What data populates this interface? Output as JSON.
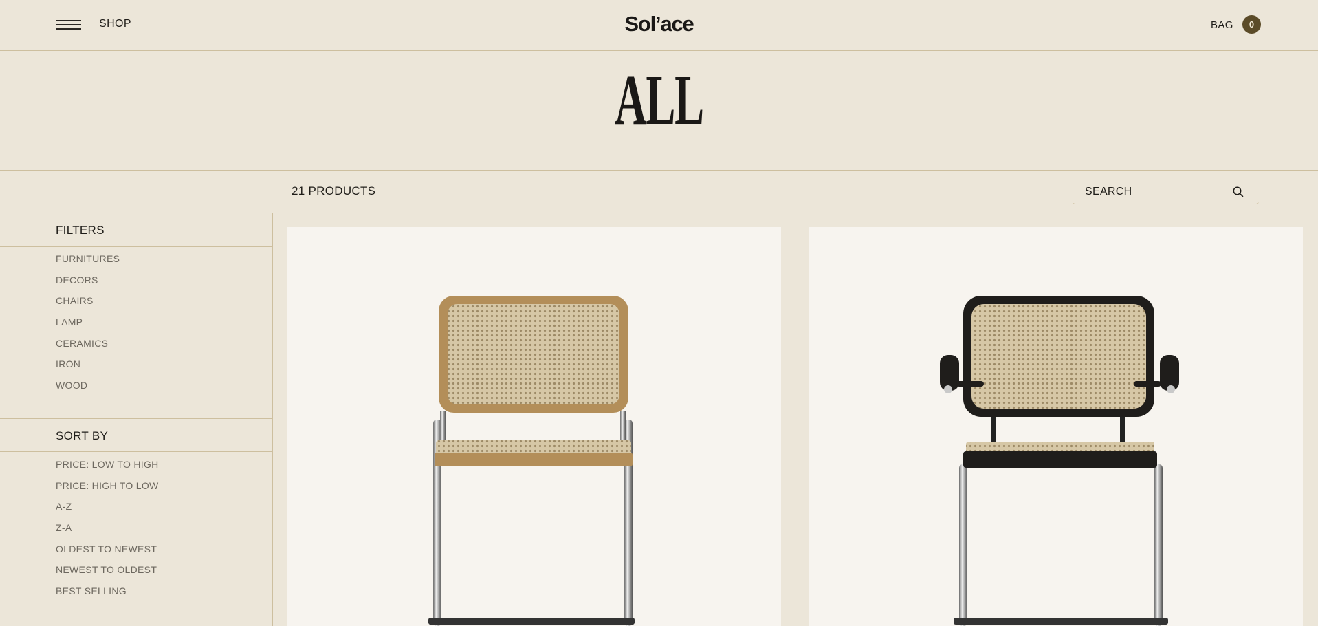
{
  "header": {
    "menu_icon": "hamburger-icon",
    "shop_label": "SHOP",
    "logo": "Sol’ace",
    "bag_label": "BAG",
    "bag_count": "0"
  },
  "hero": {
    "title": "ALL"
  },
  "toolbar": {
    "product_count": "21 PRODUCTS",
    "search_placeholder": "SEARCH",
    "search_icon": "search-icon"
  },
  "sidebar": {
    "filters_title": "FILTERS",
    "filters": [
      "FURNITURES",
      "DECORS",
      "CHAIRS",
      "LAMP",
      "CERAMICS",
      "IRON",
      "WOOD"
    ],
    "sort_title": "SORT BY",
    "sort_options": [
      "PRICE: LOW TO HIGH",
      "PRICE: HIGH TO LOW",
      "A-Z",
      "Z-A",
      "OLDEST TO NEWEST",
      "NEWEST TO OLDEST",
      "BEST SELLING"
    ]
  },
  "products": [
    {
      "image": "cane-chair-natural-wood"
    },
    {
      "image": "cane-armchair-black-frame"
    }
  ],
  "colors": {
    "background": "#ece6d9",
    "card": "#f7f4ef",
    "border": "#cdbf9f",
    "bag_badge": "#5b4b28",
    "text": "#1f1d19",
    "muted_text": "#6d685f"
  }
}
